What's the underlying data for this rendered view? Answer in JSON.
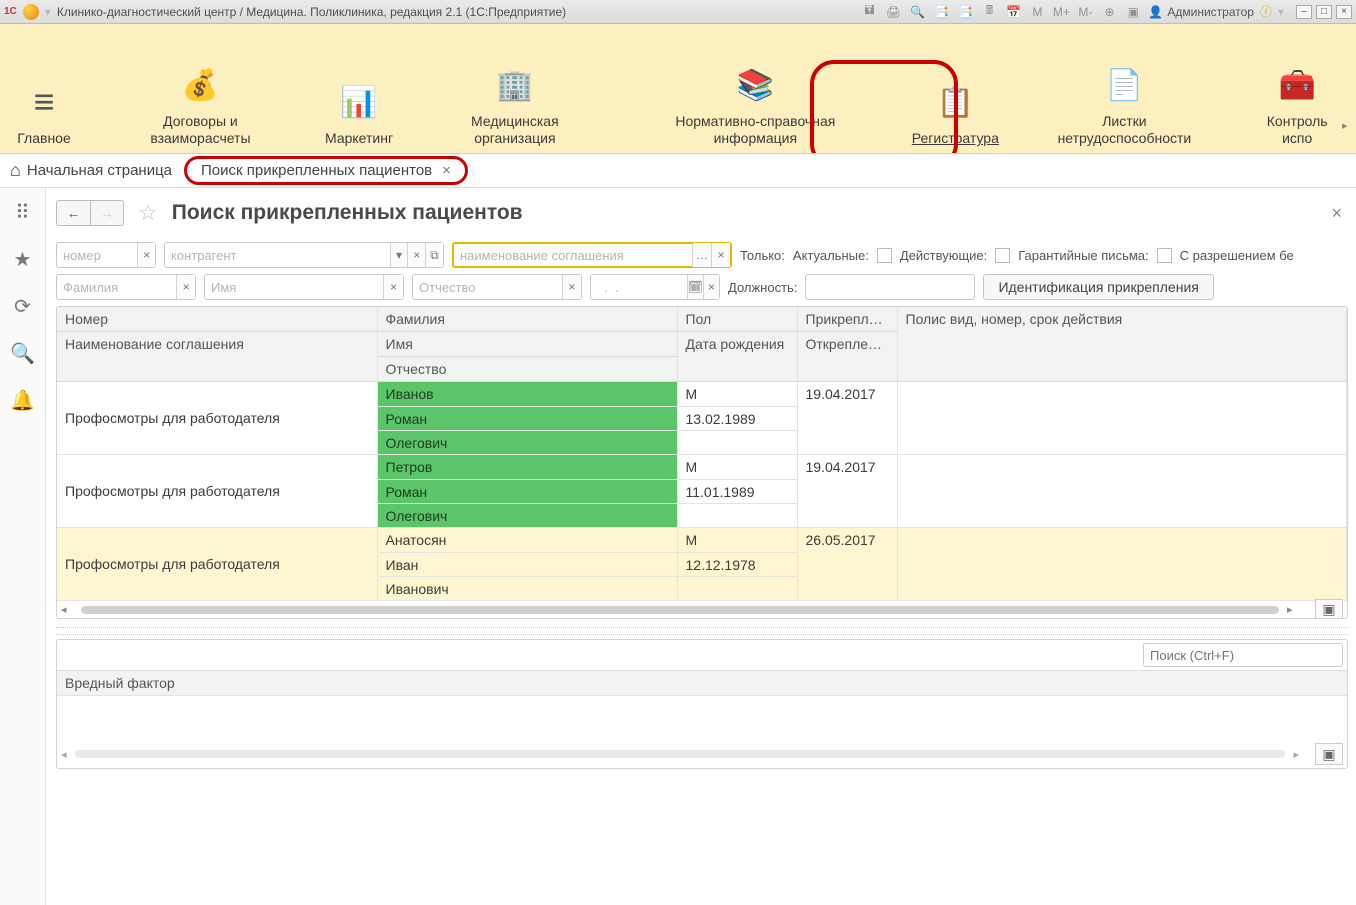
{
  "title_bar": {
    "title": "Клинико-диагностический центр / Медицина. Поликлиника, редакция 2.1  (1С:Предприятие)",
    "user": "Администратор",
    "mem_btns": [
      "M",
      "M+",
      "M-"
    ]
  },
  "main_menu": {
    "items": [
      {
        "label": "Главное",
        "icon": "≡"
      },
      {
        "label": "Договоры и взаиморасчеты",
        "icon": "💰"
      },
      {
        "label": "Маркетинг",
        "icon": "📊"
      },
      {
        "label": "Медицинская организация",
        "icon": "🏢"
      },
      {
        "label": "Нормативно-справочная информация",
        "icon": "📚"
      },
      {
        "label": "Регистратура",
        "icon": "📋",
        "underline": true,
        "highlighted": true
      },
      {
        "label": "Листки нетрудоспособности",
        "icon": "📄"
      },
      {
        "label": "Контроль испо",
        "icon": "🧰"
      }
    ]
  },
  "tabs": {
    "home": "Начальная страница",
    "current": "Поиск прикрепленных пациентов"
  },
  "page": {
    "title": "Поиск прикрепленных пациентов"
  },
  "filters": {
    "row1": {
      "nomer_ph": "номер",
      "contragent_ph": "контрагент",
      "agreement_ph": "наименование соглашения",
      "only_label": "Только:",
      "actual_label": "Актуальные:",
      "active_label": "Действующие:",
      "warranty_label": "Гарантийные письма:",
      "permission_label": "С разрешением бе"
    },
    "row2": {
      "fam_ph": "Фамилия",
      "name_ph": "Имя",
      "patr_ph": "Отчество",
      "date_ph": "  .  .",
      "position_label": "Должность:",
      "ident_btn": "Идентификация прикрепления"
    }
  },
  "table": {
    "headers": {
      "r1": {
        "c0": "Номер",
        "c1": "Фамилия",
        "c2": "Пол",
        "c3": "Прикреплен ...",
        "c4": "Полис вид, номер, срок действия"
      },
      "r2": {
        "c0": "Наименование соглашения",
        "c1": "Имя",
        "c2": "Дата рождения",
        "c3": "Откреплен от"
      },
      "r3": {
        "c1": "Отчество"
      }
    },
    "rows": [
      {
        "agr": "Профосмотры для работодателя",
        "f": "Иванов",
        "i": "Роман",
        "o": "Олегович",
        "pol": "М",
        "dob": "13.02.1989",
        "att": "19.04.2017",
        "green": true
      },
      {
        "agr": "Профосмотры для работодателя",
        "f": "Петров",
        "i": "Роман",
        "o": "Олегович",
        "pol": "М",
        "dob": "11.01.1989",
        "att": "19.04.2017",
        "green": true
      },
      {
        "agr": "Профосмотры для работодателя",
        "f": "Анатосян",
        "i": "Иван",
        "o": "Иванович",
        "pol": "М",
        "dob": "12.12.1978",
        "att": "26.05.2017",
        "yellow": true
      }
    ]
  },
  "bottom": {
    "search_ph": "Поиск (Ctrl+F)",
    "header": "Вредный фактор"
  }
}
